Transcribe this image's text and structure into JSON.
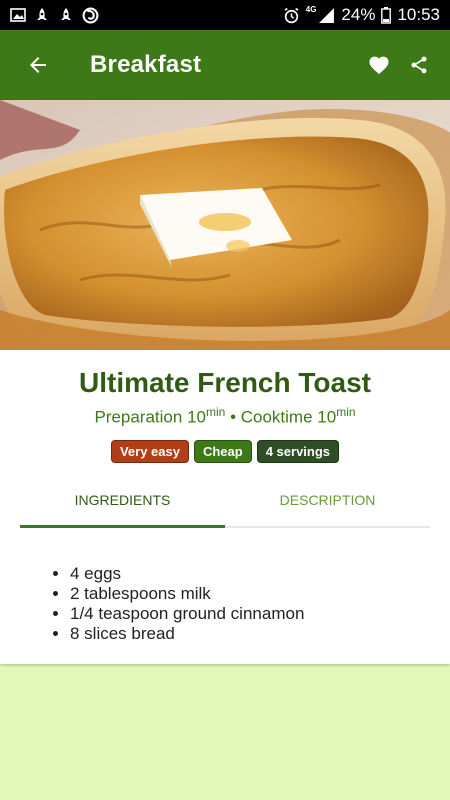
{
  "status_bar": {
    "network": "4G",
    "battery": "24%",
    "time": "10:53"
  },
  "appbar": {
    "title": "Breakfast"
  },
  "recipe": {
    "title": "Ultimate French Toast",
    "prep_label": "Preparation",
    "prep_value": "10",
    "unit": "min",
    "separator": "•",
    "cook_label": "Cooktime",
    "cook_value": "10",
    "badges": {
      "difficulty": "Very easy",
      "cost": "Cheap",
      "servings": "4 servings"
    }
  },
  "tabs": {
    "ingredients": "INGREDIENTS",
    "description": "DESCRIPTION"
  },
  "ingredients": [
    "4 eggs",
    "2 tablespoons milk",
    "1/4 teaspoon ground cinnamon",
    "8 slices bread"
  ],
  "colors": {
    "primary": "#3d7a17",
    "primary_dark": "#2f5b12",
    "background": "#e2f8b8",
    "badge_easy": "#b13e16",
    "badge_servings": "#2e4f26"
  }
}
